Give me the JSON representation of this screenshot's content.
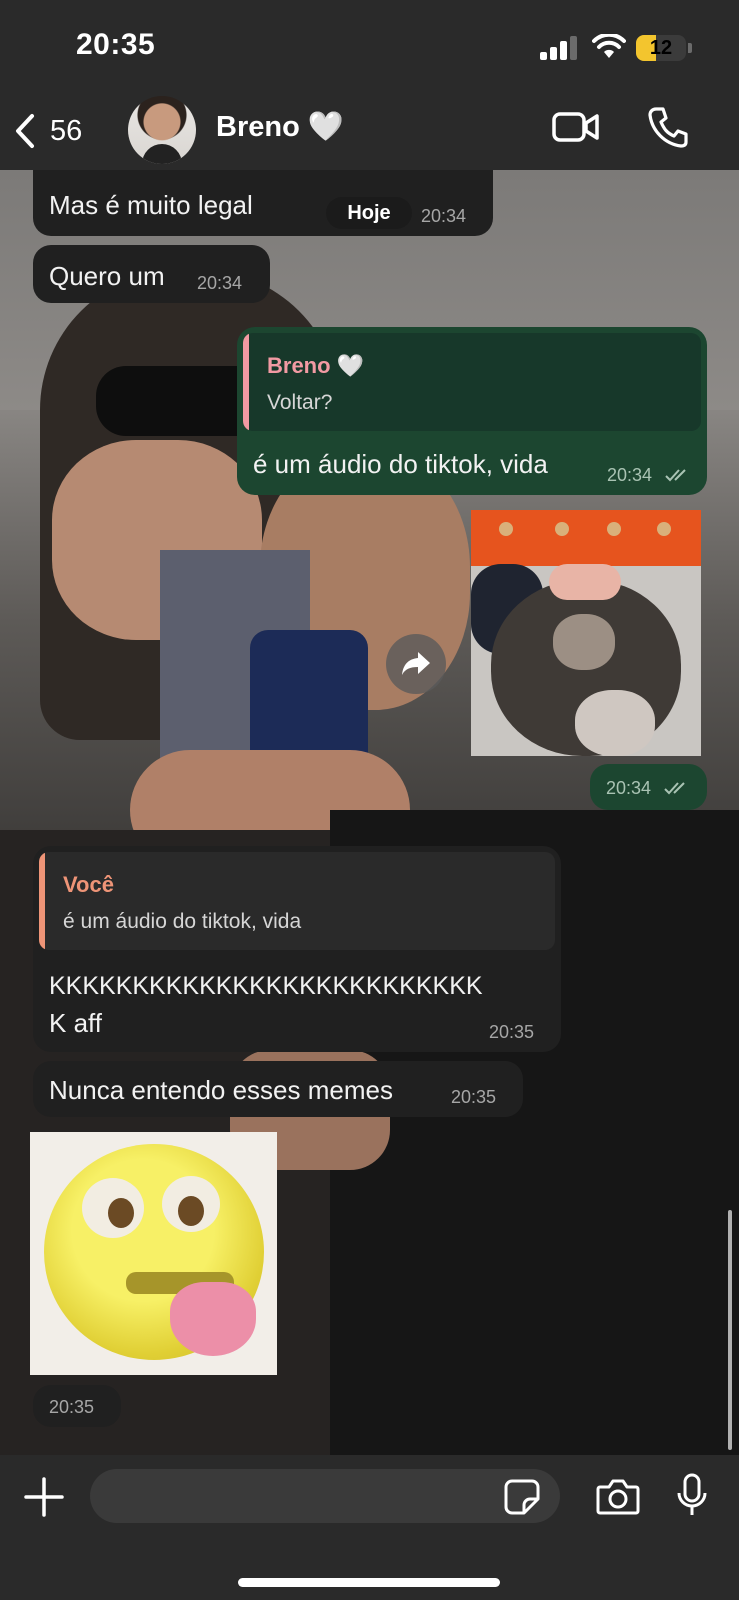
{
  "status_bar": {
    "time": "20:35",
    "battery": "12"
  },
  "header": {
    "back_count": "56",
    "contact_name": "Breno 🤍"
  },
  "date_chip": "Hoje",
  "messages": [
    {
      "text": "Mas é muito legal",
      "time": "20:34"
    },
    {
      "text": "Quero um",
      "time": "20:34"
    },
    {
      "quote_author": "Breno 🤍",
      "quote_text": "Voltar?",
      "text": "é um áudio do tiktok, vida",
      "time": "20:34"
    },
    {
      "time": "20:34"
    },
    {
      "quote_author": "Você",
      "quote_text": "é um áudio do tiktok, vida",
      "text_line1": "KKKKKKKKKKKKKKKKKKKKKKKKKK",
      "text_line2": "K aff",
      "time": "20:35"
    },
    {
      "text": "Nunca entendo esses memes",
      "time": "20:35"
    },
    {
      "time": "20:35"
    }
  ],
  "composer": {
    "placeholder": ""
  },
  "colors": {
    "out_bubble": "#1c4630",
    "in_bubble": "#202020",
    "quote_accent_out": "#f29aa3",
    "quote_accent_in": "#ee9477"
  }
}
